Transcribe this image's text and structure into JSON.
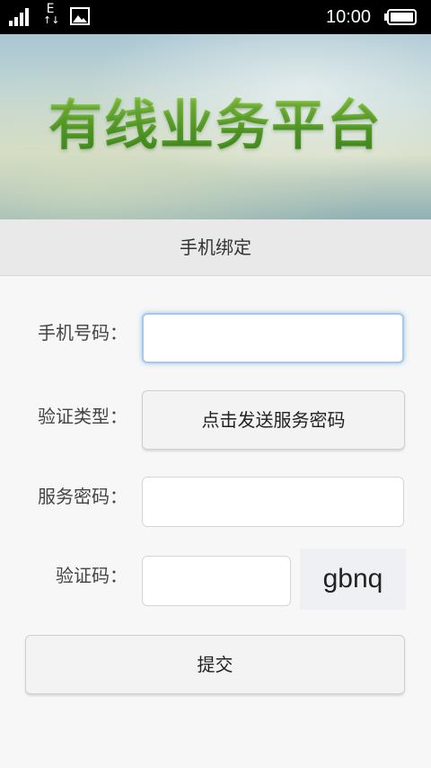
{
  "status_bar": {
    "time": "10:00",
    "network_type": "E",
    "network_arrows": "↑↓",
    "icons": [
      "signal-icon",
      "image-icon",
      "battery-icon"
    ]
  },
  "banner": {
    "title": "有线业务平台"
  },
  "header": {
    "title": "手机绑定"
  },
  "form": {
    "phone_label": "手机号码：",
    "phone_value": "",
    "verify_type_label": "验证类型：",
    "send_password_button": "点击发送服务密码",
    "service_password_label": "服务密码：",
    "service_password_value": "",
    "captcha_label": "验证码：",
    "captcha_value": "",
    "captcha_text": "gbnq",
    "submit_button": "提交"
  },
  "colors": {
    "status_bar_bg": "#000000",
    "banner_title_green": "#5aa82a",
    "header_bg": "#e9e9e9",
    "page_bg": "#f7f7f7",
    "focus_border": "#a8c8ea"
  }
}
